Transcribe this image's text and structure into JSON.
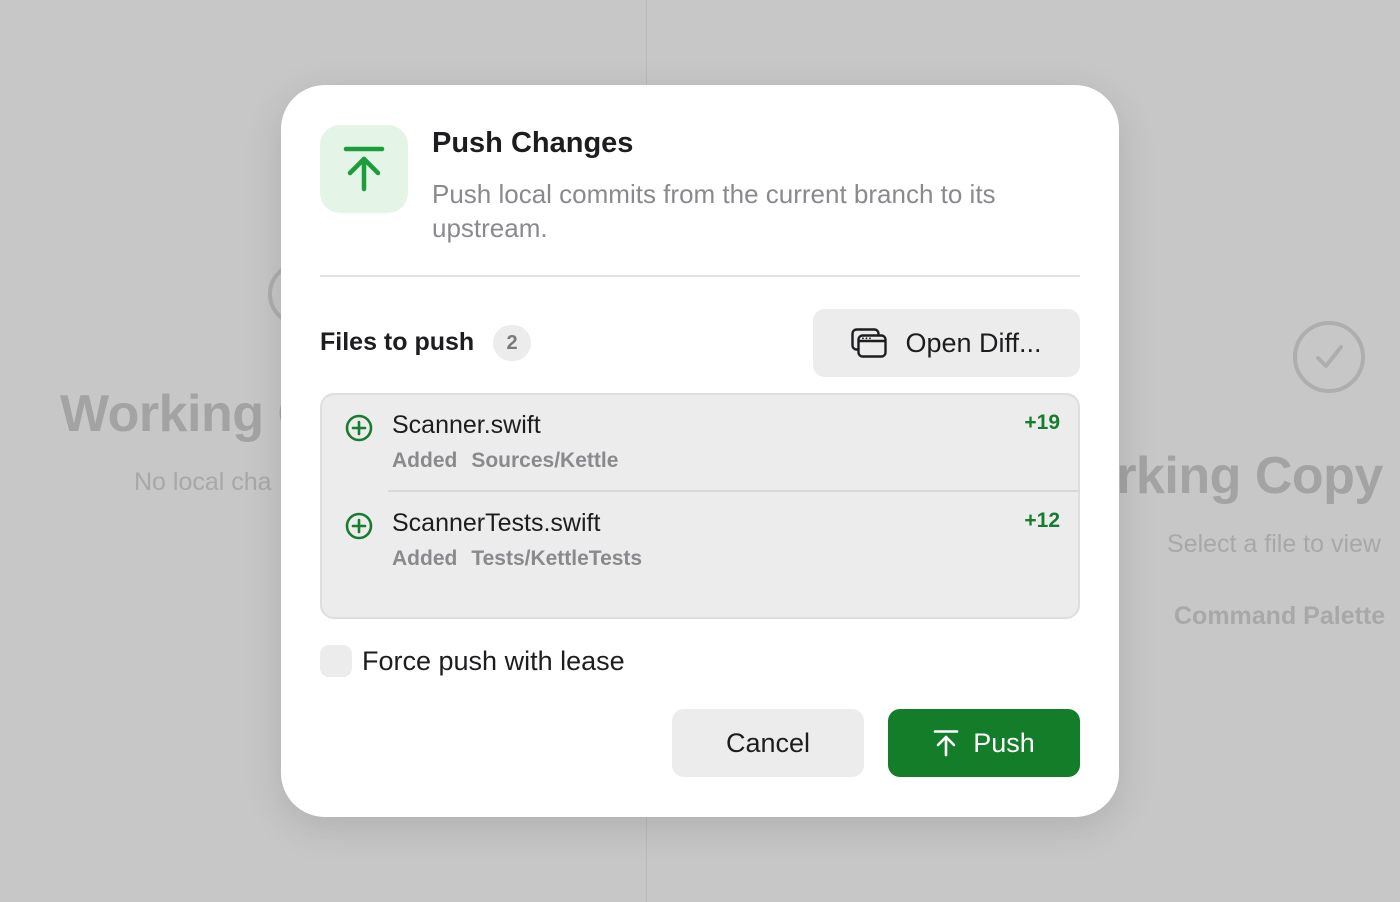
{
  "background": {
    "left_title": "Working C",
    "left_subtitle": "No local cha",
    "right_title": "orking Copy",
    "right_subtitle": "Select a file to view",
    "right_command": "Command Palette"
  },
  "dialog": {
    "title": "Push Changes",
    "subtitle": "Push local commits from the current branch to its upstream.",
    "header_icon": "arrow-up-to-line-icon",
    "files_label": "Files to push",
    "files_count": "2",
    "open_diff_label": "Open Diff...",
    "files": [
      {
        "name": "Scanner.swift",
        "status": "Added",
        "path": "Sources/Kettle",
        "additions": "+19"
      },
      {
        "name": "ScannerTests.swift",
        "status": "Added",
        "path": "Tests/KettleTests",
        "additions": "+12"
      }
    ],
    "force_push_label": "Force push with lease",
    "force_push_checked": false,
    "cancel_label": "Cancel",
    "push_label": "Push"
  },
  "colors": {
    "accent_green": "#137d2a",
    "icon_tile": "#e4f5e8",
    "background": "#c7c7c7"
  }
}
